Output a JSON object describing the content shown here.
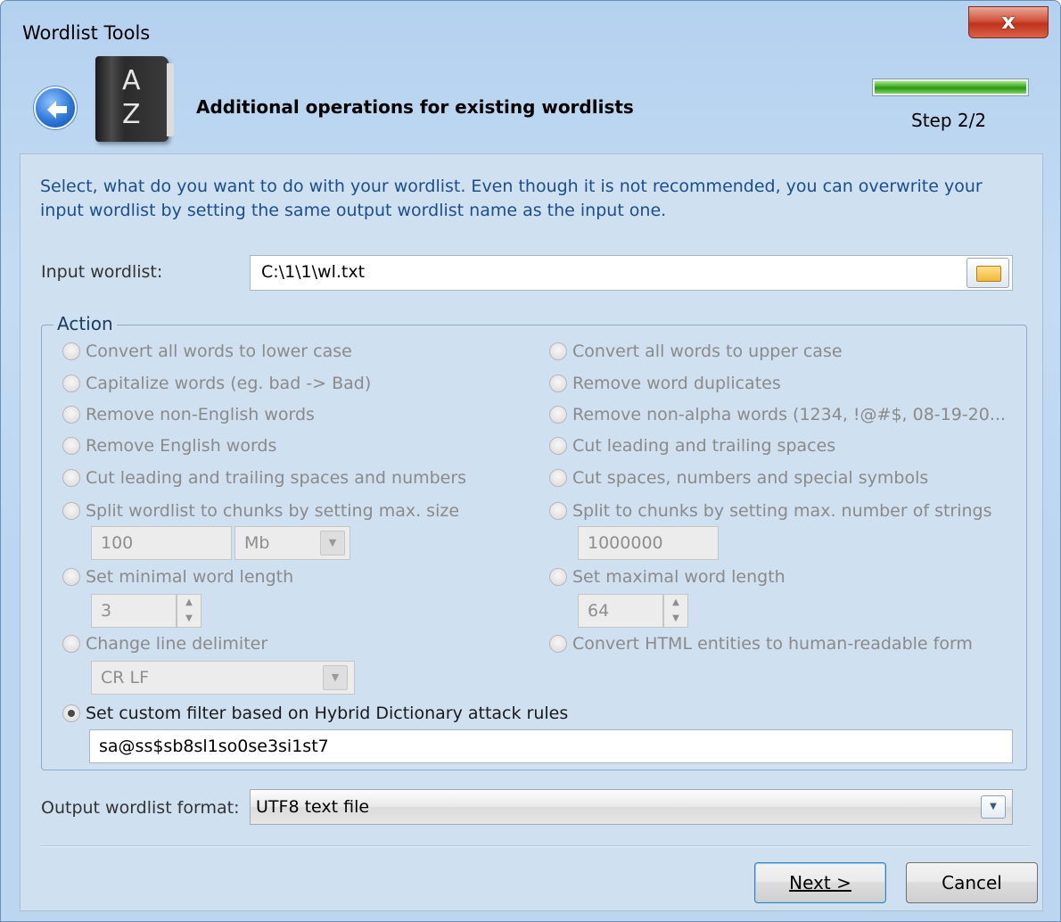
{
  "window": {
    "title": "Wordlist Tools",
    "close_label": "x"
  },
  "header": {
    "title": "Additional operations for existing wordlists",
    "step": "Step 2/2",
    "progress_percent": 100,
    "book_letters": [
      "A",
      "Z"
    ]
  },
  "intro": "Select, what do you want to do with your wordlist. Even though it is not recommended, you can overwrite your input wordlist by setting the same output wordlist name as the input one.",
  "input": {
    "label": "Input wordlist:",
    "value": "C:\\1\\1\\wl.txt"
  },
  "action": {
    "title": "Action",
    "left": [
      "Convert all words to lower case",
      "Capitalize words (eg. bad -> Bad)",
      "Remove non-English words",
      "Remove English words",
      "Cut leading and trailing spaces and numbers",
      "Split wordlist to chunks by setting max. size",
      "Set minimal word length",
      "Change line delimiter",
      "Set custom filter based on Hybrid Dictionary attack rules"
    ],
    "right": [
      "Convert all words to upper case",
      "Remove word duplicates",
      "Remove non-alpha words (1234, !@#$, 08-19-20...",
      "Cut leading and trailing spaces",
      "Cut spaces, numbers and special symbols",
      "Split to chunks by setting max. number of strings",
      "Set maximal word length",
      "Convert HTML entities to human-readable form"
    ],
    "chunk_size_value": "100",
    "chunk_size_unit": "Mb",
    "chunk_strings_value": "1000000",
    "min_length": "3",
    "max_length": "64",
    "line_delimiter": "CR LF",
    "custom_filter": "sa@ss$sb8sl1so0se3si1st7",
    "selected": "Set custom filter based on Hybrid Dictionary attack rules"
  },
  "output": {
    "label": "Output wordlist format:",
    "value": "UTF8 text file"
  },
  "buttons": {
    "next": "Next >",
    "cancel": "Cancel"
  }
}
